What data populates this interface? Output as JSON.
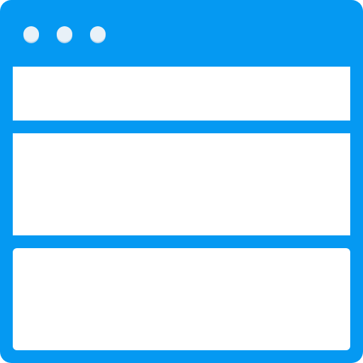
{
  "icon": {
    "name": "browser-window-icon",
    "colors": {
      "frame": "#0599F2",
      "content": "#FFFFFF",
      "dot_fill": "#E8F1F8",
      "dot_shadow": "#B9D7EE"
    },
    "window": {
      "controls": [
        {
          "name": "window-dot-1"
        },
        {
          "name": "window-dot-2"
        },
        {
          "name": "window-dot-3"
        }
      ],
      "panels": [
        {
          "name": "content-panel-top"
        },
        {
          "name": "content-panel-middle"
        },
        {
          "name": "content-panel-bottom"
        }
      ]
    }
  }
}
